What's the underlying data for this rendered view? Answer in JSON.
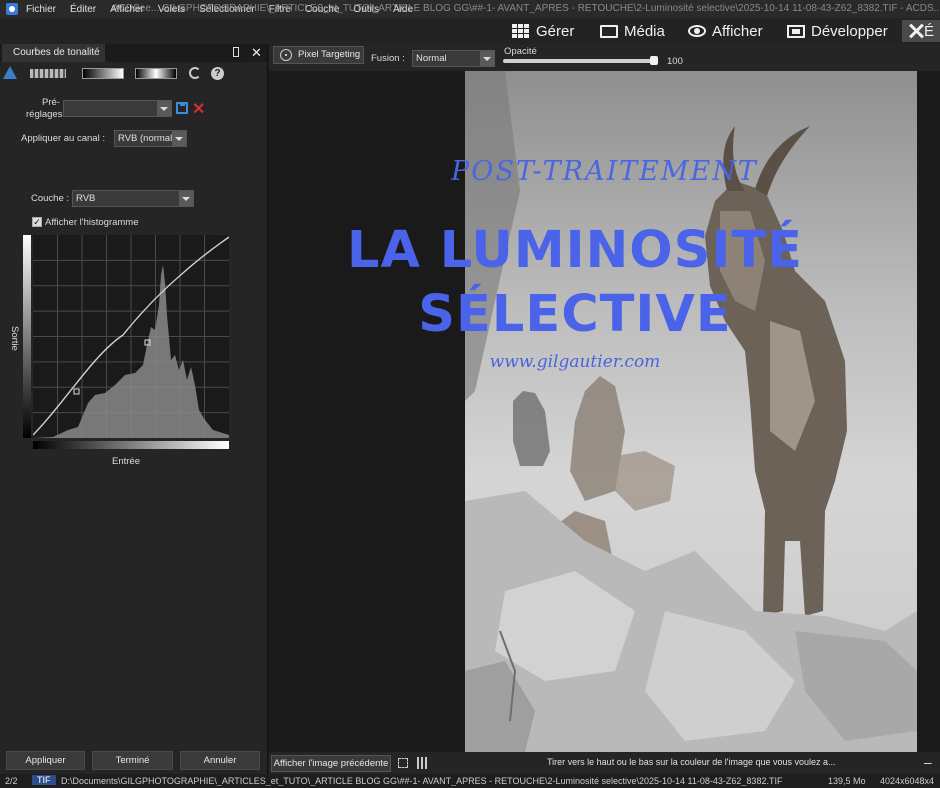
{
  "menubar": {
    "items": [
      "Fichier",
      "Éditer",
      "Afficher",
      "Volets",
      "Sélectionner",
      "Filtre",
      "Couche",
      "Outils",
      "Aide"
    ],
    "title": "ACDSee... GILGPHOTOGRAPHIE\\_ARTICLES_et_TUTO\\_ARTICLE BLOG GG\\##-1- AVANT_APRES - RETOUCHE\\2-Luminosité selective\\2025-10-14 11-08-43-Z62_8382.TIF - ACDS..."
  },
  "modes": {
    "manage": "Gérer",
    "media": "Média",
    "view": "Afficher",
    "develop": "Développer",
    "edit": "É"
  },
  "panel": {
    "tab": "Courbes de tonalité",
    "presets_label_1": "Pré-",
    "presets_label_2": "réglages",
    "channel_label": "Appliquer au canal :",
    "channel_value": "RVB (normal)",
    "layer_label": "Couche :",
    "layer_value": "RVB",
    "histogram_label": "Afficher l'histogramme",
    "output_label": "Sortie",
    "input_label": "Entrée",
    "apply": "Appliquer",
    "done": "Terminé",
    "cancel": "Annuler"
  },
  "viewer": {
    "pixel_targeting": "Pixel Targeting",
    "blend_label": "Fusion :",
    "blend_value": "Normal",
    "opacity_label": "Opacité",
    "opacity_value": "100",
    "prev_image": "Afficher l'image précédente",
    "hint": "Tirer vers le haut ou le bas sur la couleur de l'image que vous voulez a..."
  },
  "overlay": {
    "subtitle": "POST-TRAITEMENT",
    "title_line1": "LA LUMINOSITÉ",
    "title_line2": "SÉLECTIVE",
    "url": "www.gilgautier.com"
  },
  "status": {
    "count": "2/2",
    "format": "TIF",
    "path": "D:\\Documents\\GILGPHOTOGRAPHIE\\_ARTICLES_et_TUTO\\_ARTICLE BLOG GG\\##-1- AVANT_APRES - RETOUCHE\\2-Luminosité selective\\2025-10-14 11-08-43-Z62_8382.TIF",
    "size": "139,5 Mo",
    "dims": "4024x6048x4"
  },
  "colors": {
    "accent_title": "#4a63e8",
    "tif_badge": "#2c4f8c"
  }
}
